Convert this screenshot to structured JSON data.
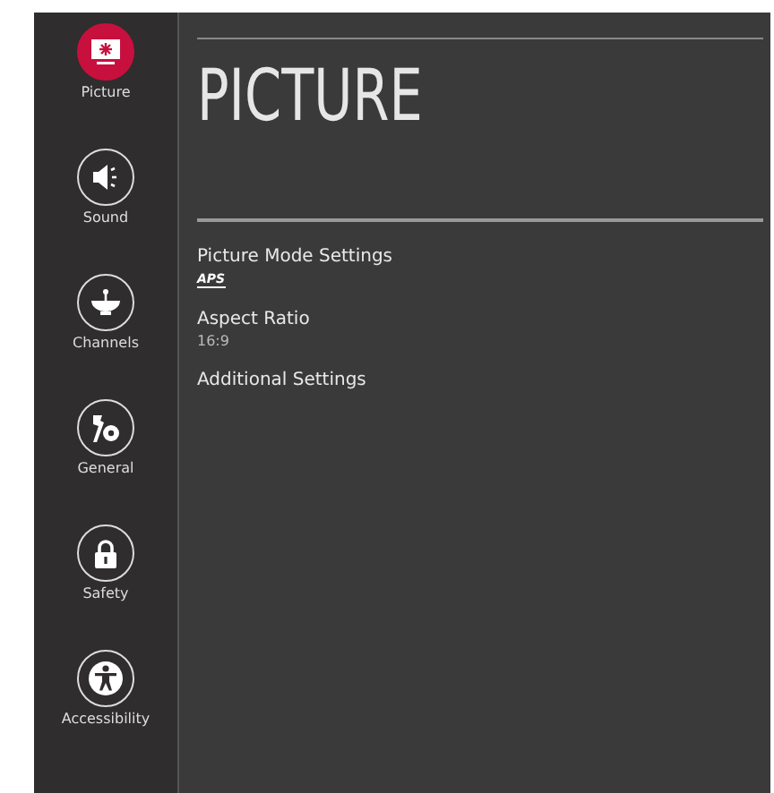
{
  "sidebar": {
    "items": [
      {
        "label": "Picture",
        "kind": "picture",
        "selected": true
      },
      {
        "label": "Sound",
        "kind": "sound",
        "selected": false
      },
      {
        "label": "Channels",
        "kind": "channels",
        "selected": false
      },
      {
        "label": "General",
        "kind": "general",
        "selected": false
      },
      {
        "label": "Safety",
        "kind": "safety",
        "selected": false
      },
      {
        "label": "Accessibility",
        "kind": "accessibility",
        "selected": false
      }
    ]
  },
  "page": {
    "title": "PICTURE",
    "settings": [
      {
        "label": "Picture Mode Settings",
        "value": "APS",
        "kind": "logo"
      },
      {
        "label": "Aspect Ratio",
        "value": "16:9",
        "kind": "text"
      },
      {
        "label": "Additional Settings",
        "kind": "plain"
      }
    ]
  }
}
